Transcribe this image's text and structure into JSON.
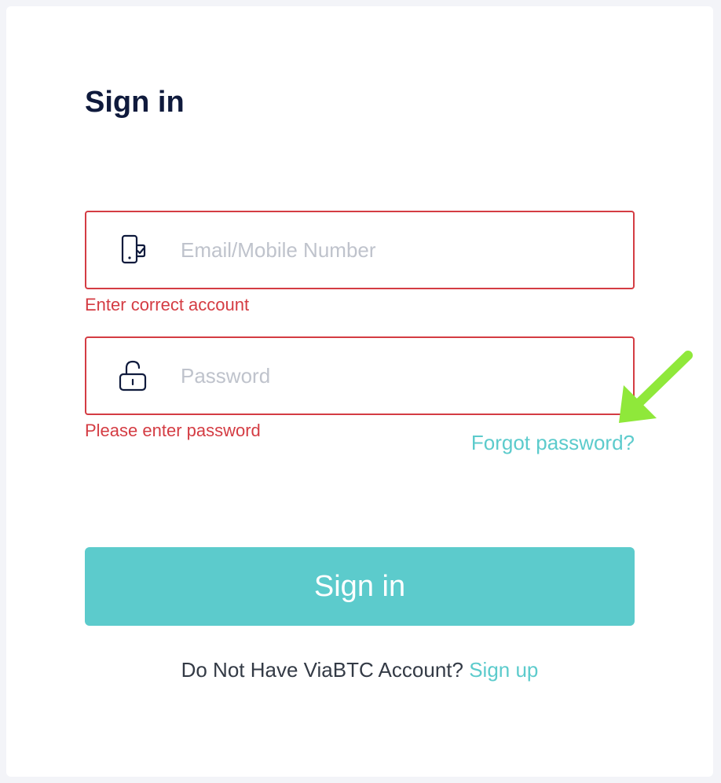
{
  "page": {
    "title": "Sign in"
  },
  "form": {
    "account": {
      "placeholder": "Email/Mobile Number",
      "value": "",
      "icon": "mobile-phone-check-icon",
      "error": "Enter correct account"
    },
    "password": {
      "placeholder": "Password",
      "value": "",
      "icon": "unlocked-padlock-icon",
      "error": "Please enter password"
    },
    "forgot_label": "Forgot password?",
    "submit_label": "Sign in"
  },
  "footer": {
    "prompt": "Do Not Have ViaBTC Account?",
    "signup_label": "Sign up"
  },
  "colors": {
    "accent": "#5ccbcc",
    "error": "#d43c43",
    "title": "#0f1a3c",
    "annotation_arrow": "#8fe83a"
  }
}
